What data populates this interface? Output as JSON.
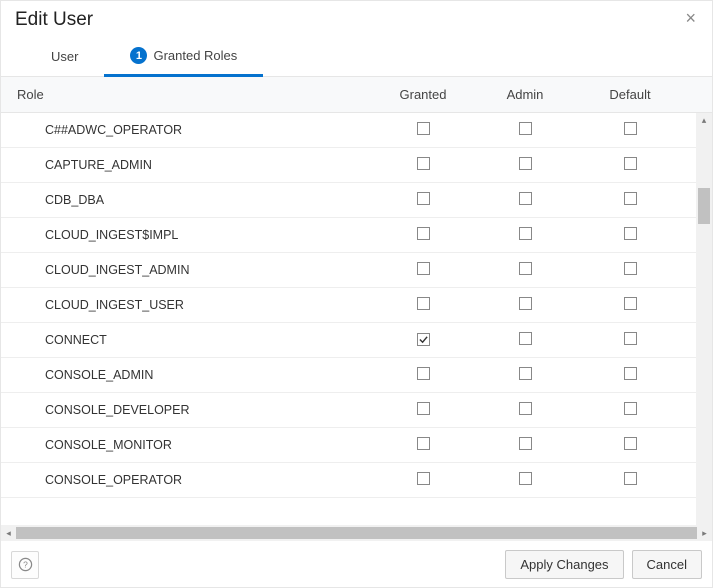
{
  "dialog": {
    "title": "Edit User"
  },
  "tabs": {
    "user": {
      "label": "User"
    },
    "granted": {
      "label": "Granted Roles",
      "badge": "1"
    }
  },
  "columns": {
    "role": "Role",
    "granted": "Granted",
    "admin": "Admin",
    "default": "Default"
  },
  "roles": [
    {
      "name": "C##ADWC_OPERATOR",
      "granted": false,
      "admin": false,
      "default": false
    },
    {
      "name": "CAPTURE_ADMIN",
      "granted": false,
      "admin": false,
      "default": false
    },
    {
      "name": "CDB_DBA",
      "granted": false,
      "admin": false,
      "default": false
    },
    {
      "name": "CLOUD_INGEST$IMPL",
      "granted": false,
      "admin": false,
      "default": false
    },
    {
      "name": "CLOUD_INGEST_ADMIN",
      "granted": false,
      "admin": false,
      "default": false
    },
    {
      "name": "CLOUD_INGEST_USER",
      "granted": false,
      "admin": false,
      "default": false
    },
    {
      "name": "CONNECT",
      "granted": true,
      "admin": false,
      "default": false
    },
    {
      "name": "CONSOLE_ADMIN",
      "granted": false,
      "admin": false,
      "default": false
    },
    {
      "name": "CONSOLE_DEVELOPER",
      "granted": false,
      "admin": false,
      "default": false
    },
    {
      "name": "CONSOLE_MONITOR",
      "granted": false,
      "admin": false,
      "default": false
    },
    {
      "name": "CONSOLE_OPERATOR",
      "granted": false,
      "admin": false,
      "default": false
    }
  ],
  "footer": {
    "apply": "Apply Changes",
    "cancel": "Cancel"
  }
}
